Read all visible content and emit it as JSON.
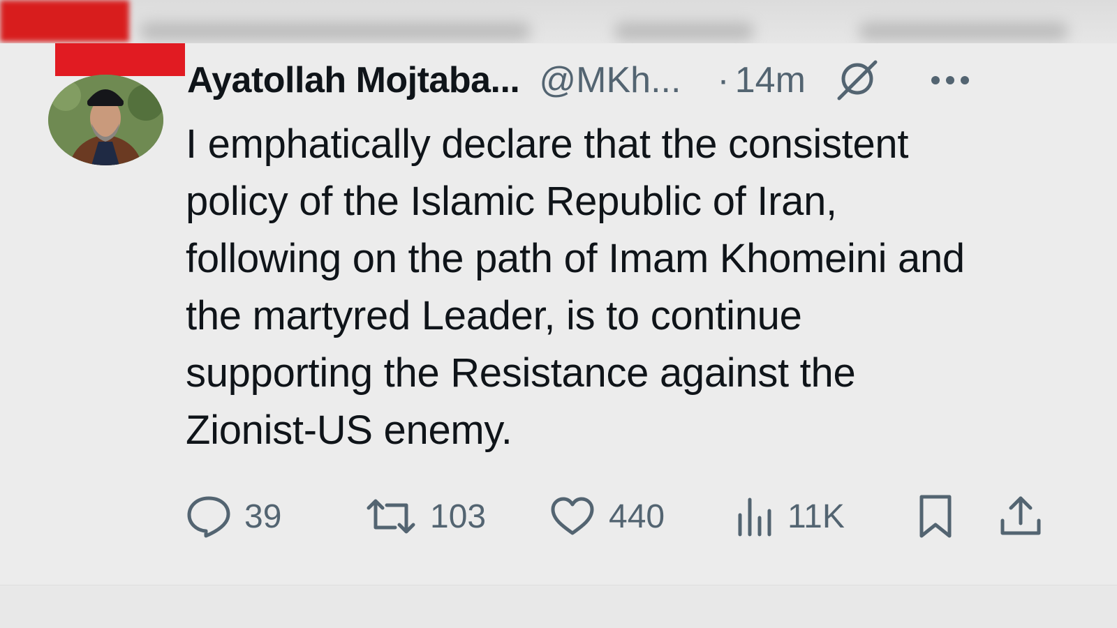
{
  "post": {
    "author_name": "Ayatollah Mojtaba...",
    "author_handle": "@MKh...",
    "separator": "·",
    "time_ago": "14m",
    "body": "I emphatically declare that the consistent\npolicy of the Islamic Republic of Iran,\nfollowing on the path of Imam Khomeini and\nthe martyred Leader, is to continue\nsupporting the Resistance against the\nZionist-US enemy.",
    "header_icons": [
      "grok-icon",
      "more-options-icon"
    ]
  },
  "actions": {
    "replies": {
      "icon": "reply-icon",
      "count": "39"
    },
    "reposts": {
      "icon": "repost-icon",
      "count": "103"
    },
    "likes": {
      "icon": "heart-icon",
      "count": "440"
    },
    "views": {
      "icon": "views-icon",
      "count": "11K"
    },
    "bookmark": {
      "icon": "bookmark-icon"
    },
    "share": {
      "icon": "share-icon"
    }
  },
  "colors": {
    "background": "#ececec",
    "primary_text": "#0f1419",
    "secondary_text": "#536471",
    "red_overlay": "#e11b22"
  }
}
